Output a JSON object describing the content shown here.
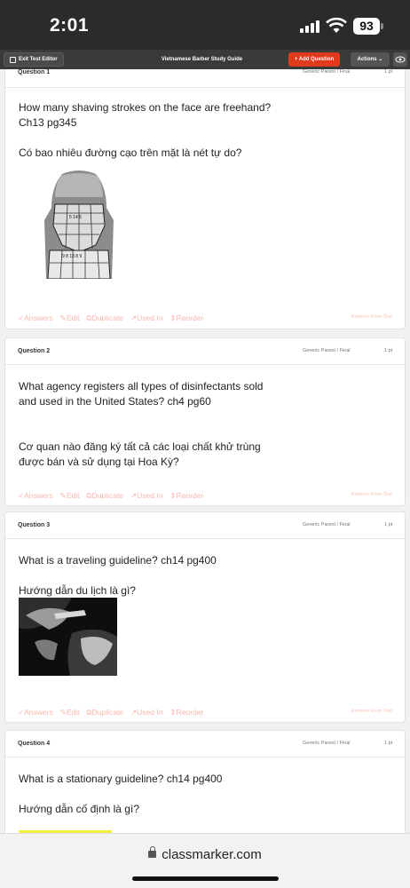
{
  "status_bar": {
    "time": "2:01",
    "battery": "93"
  },
  "toolbar": {
    "exit_label": "Exit Test Editor",
    "title": "Vietnamese Barber Study Guide",
    "add_label": "+ Add Question",
    "actions_label": "Actions ⌄"
  },
  "questions": [
    {
      "label": "Question 1",
      "parent": "Generic Parent  / Final",
      "points": "1 pt",
      "text": "How many shaving strokes on the face are freehand?\nCh13 pg345\n\nCó bao nhiêu đường cạo trên mặt là nét tự do?",
      "image": "head-diagram"
    },
    {
      "label": "Question 2",
      "parent": "Generic Parent  / Final",
      "points": "1 pt",
      "text": "What agency registers all types of disinfectants sold\nand used in the United States? ch4 pg60\n\n\nCơ quan nào đăng ký tất cả các loại chất khử trùng\nđược bán và sử dụng tại Hoa Kỳ?"
    },
    {
      "label": "Question 3",
      "parent": "Generic Parent  / Final",
      "points": "1 pt",
      "text": "What is a traveling guideline? ch14 pg400\n\nHướng dẫn du lịch là gì?",
      "image": "haircut-photo"
    },
    {
      "label": "Question 4",
      "parent": "Generic Parent  / Final",
      "points": "1 pt",
      "text": "What is a stationary guideline? ch14 pg400\n\nHướng dẫn cố định là gì?"
    }
  ],
  "card_actions": {
    "answers": "✓Answers",
    "edit": "✎Edit",
    "duplicate": "⧉Duplicate",
    "used_in": "↗Used In",
    "reorder": "⇕Reorder",
    "remove": "Remove From Test"
  },
  "url": {
    "domain": "classmarker.com"
  },
  "colors": {
    "accent": "#e03a1c",
    "toolbar": "#3a3a3a",
    "action_text": "#f7b7aa"
  }
}
